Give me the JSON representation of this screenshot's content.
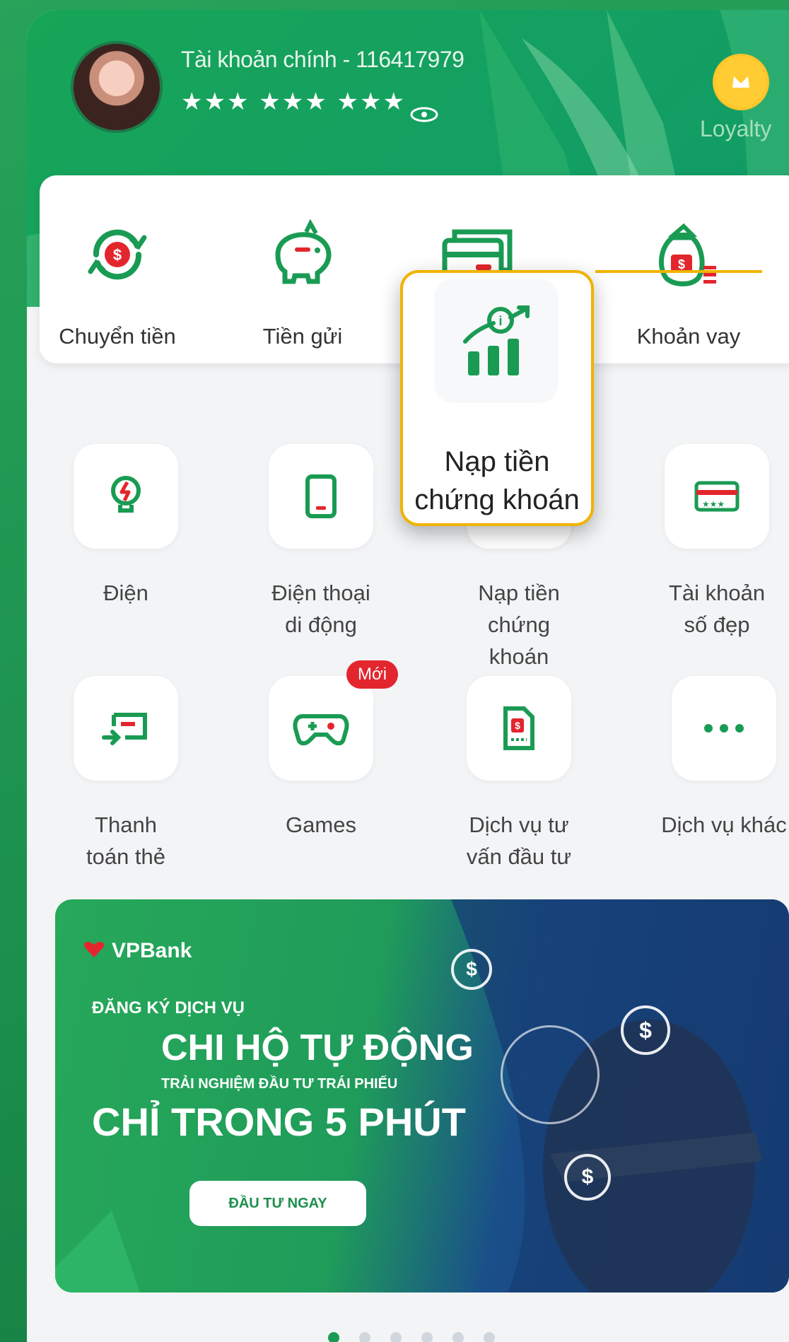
{
  "header": {
    "account_title": "Tài khoản chính - 116417979",
    "balance_masked": "★★★ ★★★ ★★★",
    "loyalty_label": "Loyalty"
  },
  "quick_actions": [
    {
      "label": "Chuyển tiền",
      "icon": "money-transfer-icon"
    },
    {
      "label": "Tiền gửi",
      "icon": "piggy-bank-icon"
    },
    {
      "label": "",
      "icon": "card-icon"
    },
    {
      "label": "Khoản vay",
      "icon": "loan-bag-icon"
    }
  ],
  "highlight": {
    "label": "Nạp tiền chứng khoán",
    "border_color": "#f0b300"
  },
  "services": [
    {
      "label": "Điện",
      "icon": "lightbulb-icon"
    },
    {
      "label": "Điện thoại di động",
      "icon": "mobile-phone-icon"
    },
    {
      "label": "Nạp tiền chứng khoán",
      "icon": "stock-topup-icon"
    },
    {
      "label": "Tài khoản số đẹp",
      "icon": "vanity-account-icon"
    },
    {
      "label": "Thanh toán thẻ",
      "icon": "card-payment-icon"
    },
    {
      "label": "Games",
      "icon": "gamepad-icon",
      "badge": "Mới"
    },
    {
      "label": "Dịch vụ tư vấn đầu tư",
      "icon": "investment-advice-icon"
    },
    {
      "label": "Dịch vụ khác",
      "icon": "more-icon"
    }
  ],
  "banner": {
    "brand": "VPBank",
    "line1": "ĐĂNG KÝ DỊCH VỤ",
    "line2": "CHI HỘ TỰ ĐỘNG",
    "line3": "TRẢI NGHIỆM ĐẦU TƯ TRÁI PHIẾU",
    "line4": "CHỈ TRONG 5 PHÚT",
    "cta": "ĐẦU TƯ NGAY"
  },
  "carousel": {
    "count": 6,
    "active": 1
  },
  "colors": {
    "primary": "#1a9b53",
    "accent": "#f0b300",
    "badge": "#e3262d"
  }
}
